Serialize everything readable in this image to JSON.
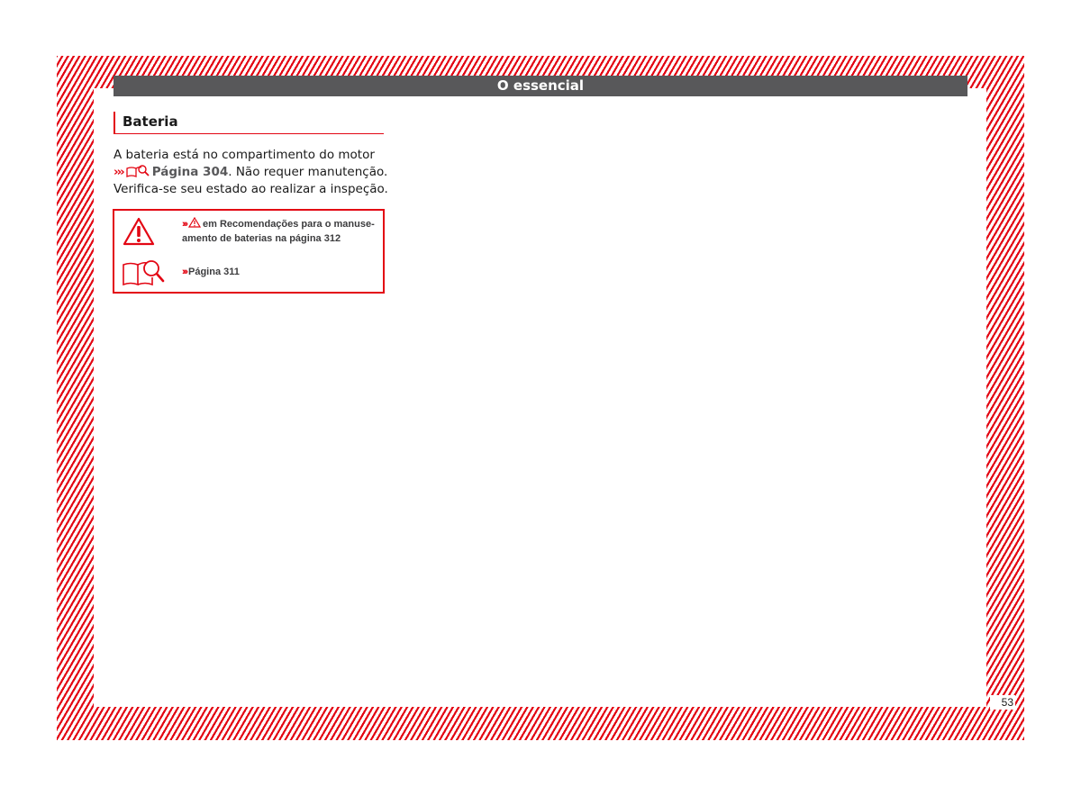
{
  "header": {
    "title": "O essencial"
  },
  "section": {
    "heading": "Bateria"
  },
  "body": {
    "line1": "A bateria está no compartimento do motor",
    "line2_arrows": "›››",
    "line2_ref": "Página 304",
    "line2_rest": ". Não requer manutenção.",
    "line3": "Verifica-se seu estado ao realizar a inspeção."
  },
  "info_box": {
    "warning_arrows": "›››",
    "warning_line1": "em Recomendações para o manuse-",
    "warning_line2": "amento de baterias na página 312",
    "reference_arrows": "›››",
    "reference_text": "Página 311",
    "warning_icon": "warning-triangle-icon",
    "reference_icon": "book-magnifier-icon"
  },
  "footer": {
    "page_number": "53"
  },
  "colors": {
    "accent": "#e30613",
    "header_bg": "#58585a",
    "text": "#1a1a1a"
  }
}
